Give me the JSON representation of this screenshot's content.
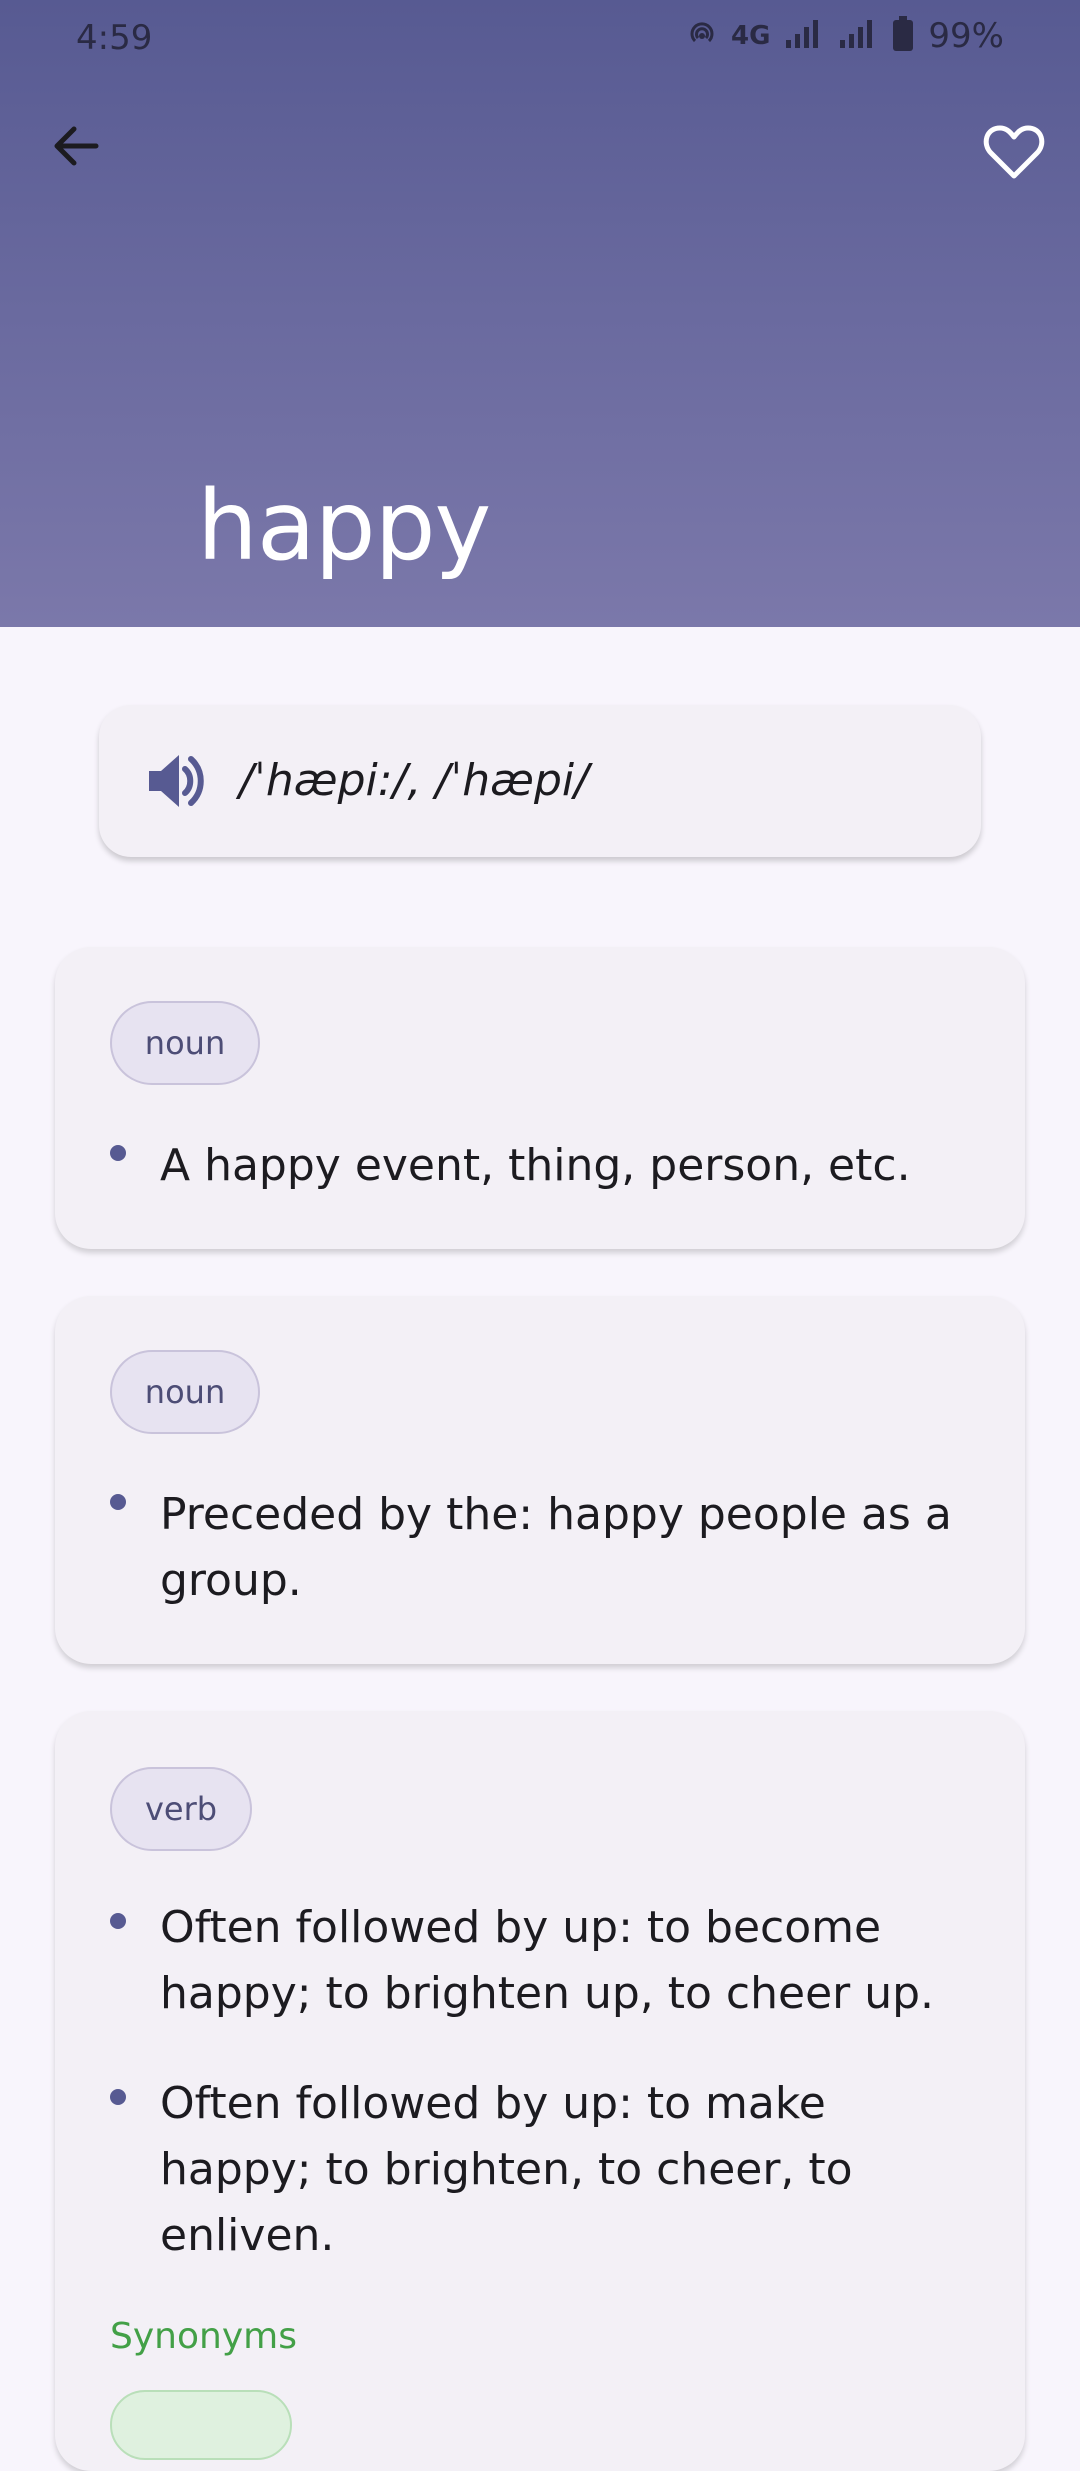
{
  "status_bar": {
    "time": "4:59",
    "network": "4G",
    "battery": "99%"
  },
  "header": {
    "word": "happy"
  },
  "pronunciation": {
    "text": "/ˈhæpi:/, /ˈhæpi/"
  },
  "definitions": [
    {
      "part_of_speech": "noun",
      "items": [
        "A happy event, thing, person, etc."
      ]
    },
    {
      "part_of_speech": "noun",
      "items": [
        "Preceded by the: happy people as a group."
      ]
    },
    {
      "part_of_speech": "verb",
      "items": [
        "Often followed by up: to become happy; to brighten up, to cheer up.",
        "Often followed by up: to make happy; to brighten, to cheer, to enliven."
      ],
      "synonyms_label": "Synonyms"
    }
  ],
  "colors": {
    "header_top": "#575a92",
    "header_bottom": "#7b78aa",
    "accent": "#575a92",
    "synonyms_green": "#43a047",
    "card_bg": "#f3f0f6",
    "page_bg": "#f8f5fc"
  },
  "icons": {
    "back": "arrow-left-icon",
    "favorite": "heart-outline-icon",
    "speaker": "volume-icon"
  }
}
